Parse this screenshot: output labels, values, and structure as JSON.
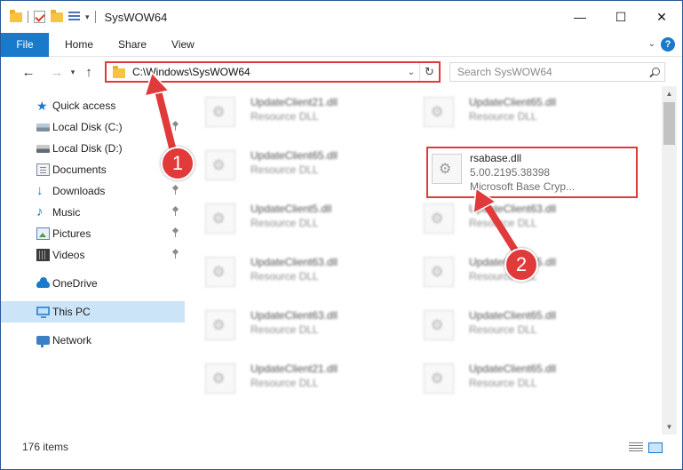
{
  "window": {
    "title": "SysWOW64",
    "minimize": "—",
    "maximize": "☐",
    "close": "✕"
  },
  "ribbon": {
    "tabs": [
      {
        "label": "File"
      },
      {
        "label": "Home"
      },
      {
        "label": "Share"
      },
      {
        "label": "View"
      }
    ],
    "help": "?"
  },
  "nav": {
    "back": "←",
    "forward": "→",
    "recent": "▾",
    "up": "↑",
    "address": "C:\\Windows\\SysWOW64",
    "search_placeholder": "Search SysWOW64"
  },
  "sidebar": {
    "items": [
      {
        "label": "Quick access",
        "icon": "star-icon"
      },
      {
        "label": "Local Disk (C:)",
        "icon": "drive-icon",
        "pinned": true
      },
      {
        "label": "Local Disk (D:)",
        "icon": "drive-icon"
      },
      {
        "label": "Documents",
        "icon": "documents-icon",
        "pinned": true
      },
      {
        "label": "Downloads",
        "icon": "downloads-icon",
        "pinned": true
      },
      {
        "label": "Music",
        "icon": "music-icon",
        "pinned": true
      },
      {
        "label": "Pictures",
        "icon": "pictures-icon",
        "pinned": true
      },
      {
        "label": "Videos",
        "icon": "videos-icon",
        "pinned": true
      },
      {
        "label": "OneDrive",
        "icon": "onedrive-icon"
      },
      {
        "label": "This PC",
        "icon": "this-pc-icon",
        "selected": true
      },
      {
        "label": "Network",
        "icon": "network-icon"
      }
    ]
  },
  "files": [
    {
      "name": "UpdateClient21.dll",
      "type": "Resource DLL"
    },
    {
      "name": "UpdateClient65.dll",
      "type": "Resource DLL"
    },
    {
      "name": "UpdateClient65.dll",
      "type": "Resource DLL"
    },
    {
      "name": "rsabase.dll",
      "version": "5.00.2195.38398",
      "description": "Microsoft Base Cryp..."
    },
    {
      "name": "UpdateClient5.dll",
      "type": "Resource DLL"
    },
    {
      "name": "UpdateClient63.dll",
      "type": "Resource DLL"
    },
    {
      "name": "UpdateClient63.dll",
      "type": "Resource DLL"
    },
    {
      "name": "UpdateClient65.dll",
      "type": "Resource DLL"
    },
    {
      "name": "UpdateClient63.dll",
      "type": "Resource DLL"
    },
    {
      "name": "UpdateClient65.dll",
      "type": "Resource DLL"
    },
    {
      "name": "UpdateClient21.dll",
      "type": "Resource DLL"
    },
    {
      "name": "UpdateClient65.dll",
      "type": "Resource DLL"
    }
  ],
  "status": {
    "item_count": "176 items"
  },
  "annotations": {
    "step1": "1",
    "step2": "2",
    "color": "#e03a3a"
  }
}
